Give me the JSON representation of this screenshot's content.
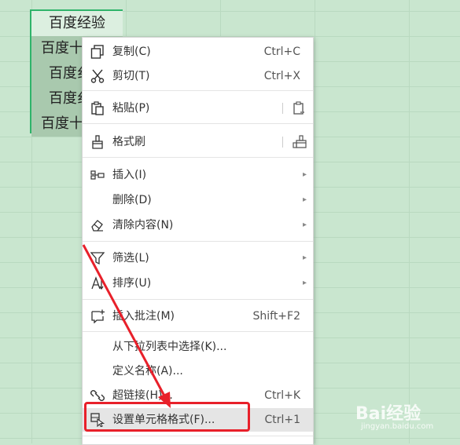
{
  "cells": [
    "百度经验",
    "百度十",
    "百度纟",
    "百度纟",
    "百度十"
  ],
  "menu": {
    "copy": {
      "label": "复制(C)",
      "shortcut": "Ctrl+C"
    },
    "cut": {
      "label": "剪切(T)",
      "shortcut": "Ctrl+X"
    },
    "paste": {
      "label": "粘贴(P)"
    },
    "format_painter": {
      "label": "格式刷"
    },
    "insert": {
      "label": "插入(I)"
    },
    "delete": {
      "label": "删除(D)"
    },
    "clear": {
      "label": "清除内容(N)"
    },
    "filter": {
      "label": "筛选(L)"
    },
    "sort": {
      "label": "排序(U)"
    },
    "insert_comment": {
      "label": "插入批注(M)",
      "shortcut": "Shift+F2"
    },
    "pick_list": {
      "label": "从下拉列表中选择(K)..."
    },
    "define_name": {
      "label": "定义名称(A)..."
    },
    "hyperlink": {
      "label": "超链接(H)...",
      "shortcut": "Ctrl+K"
    },
    "format_cells": {
      "label": "设置单元格格式(F)...",
      "shortcut": "Ctrl+1"
    },
    "submenu_arrow": "▸"
  },
  "watermark": {
    "brand": "Bai经验",
    "url": "jingyan.baidu.com"
  },
  "colors": {
    "background": "#c9e6cf",
    "selection_border": "#2fb36a",
    "annotation": "#e8202a"
  }
}
